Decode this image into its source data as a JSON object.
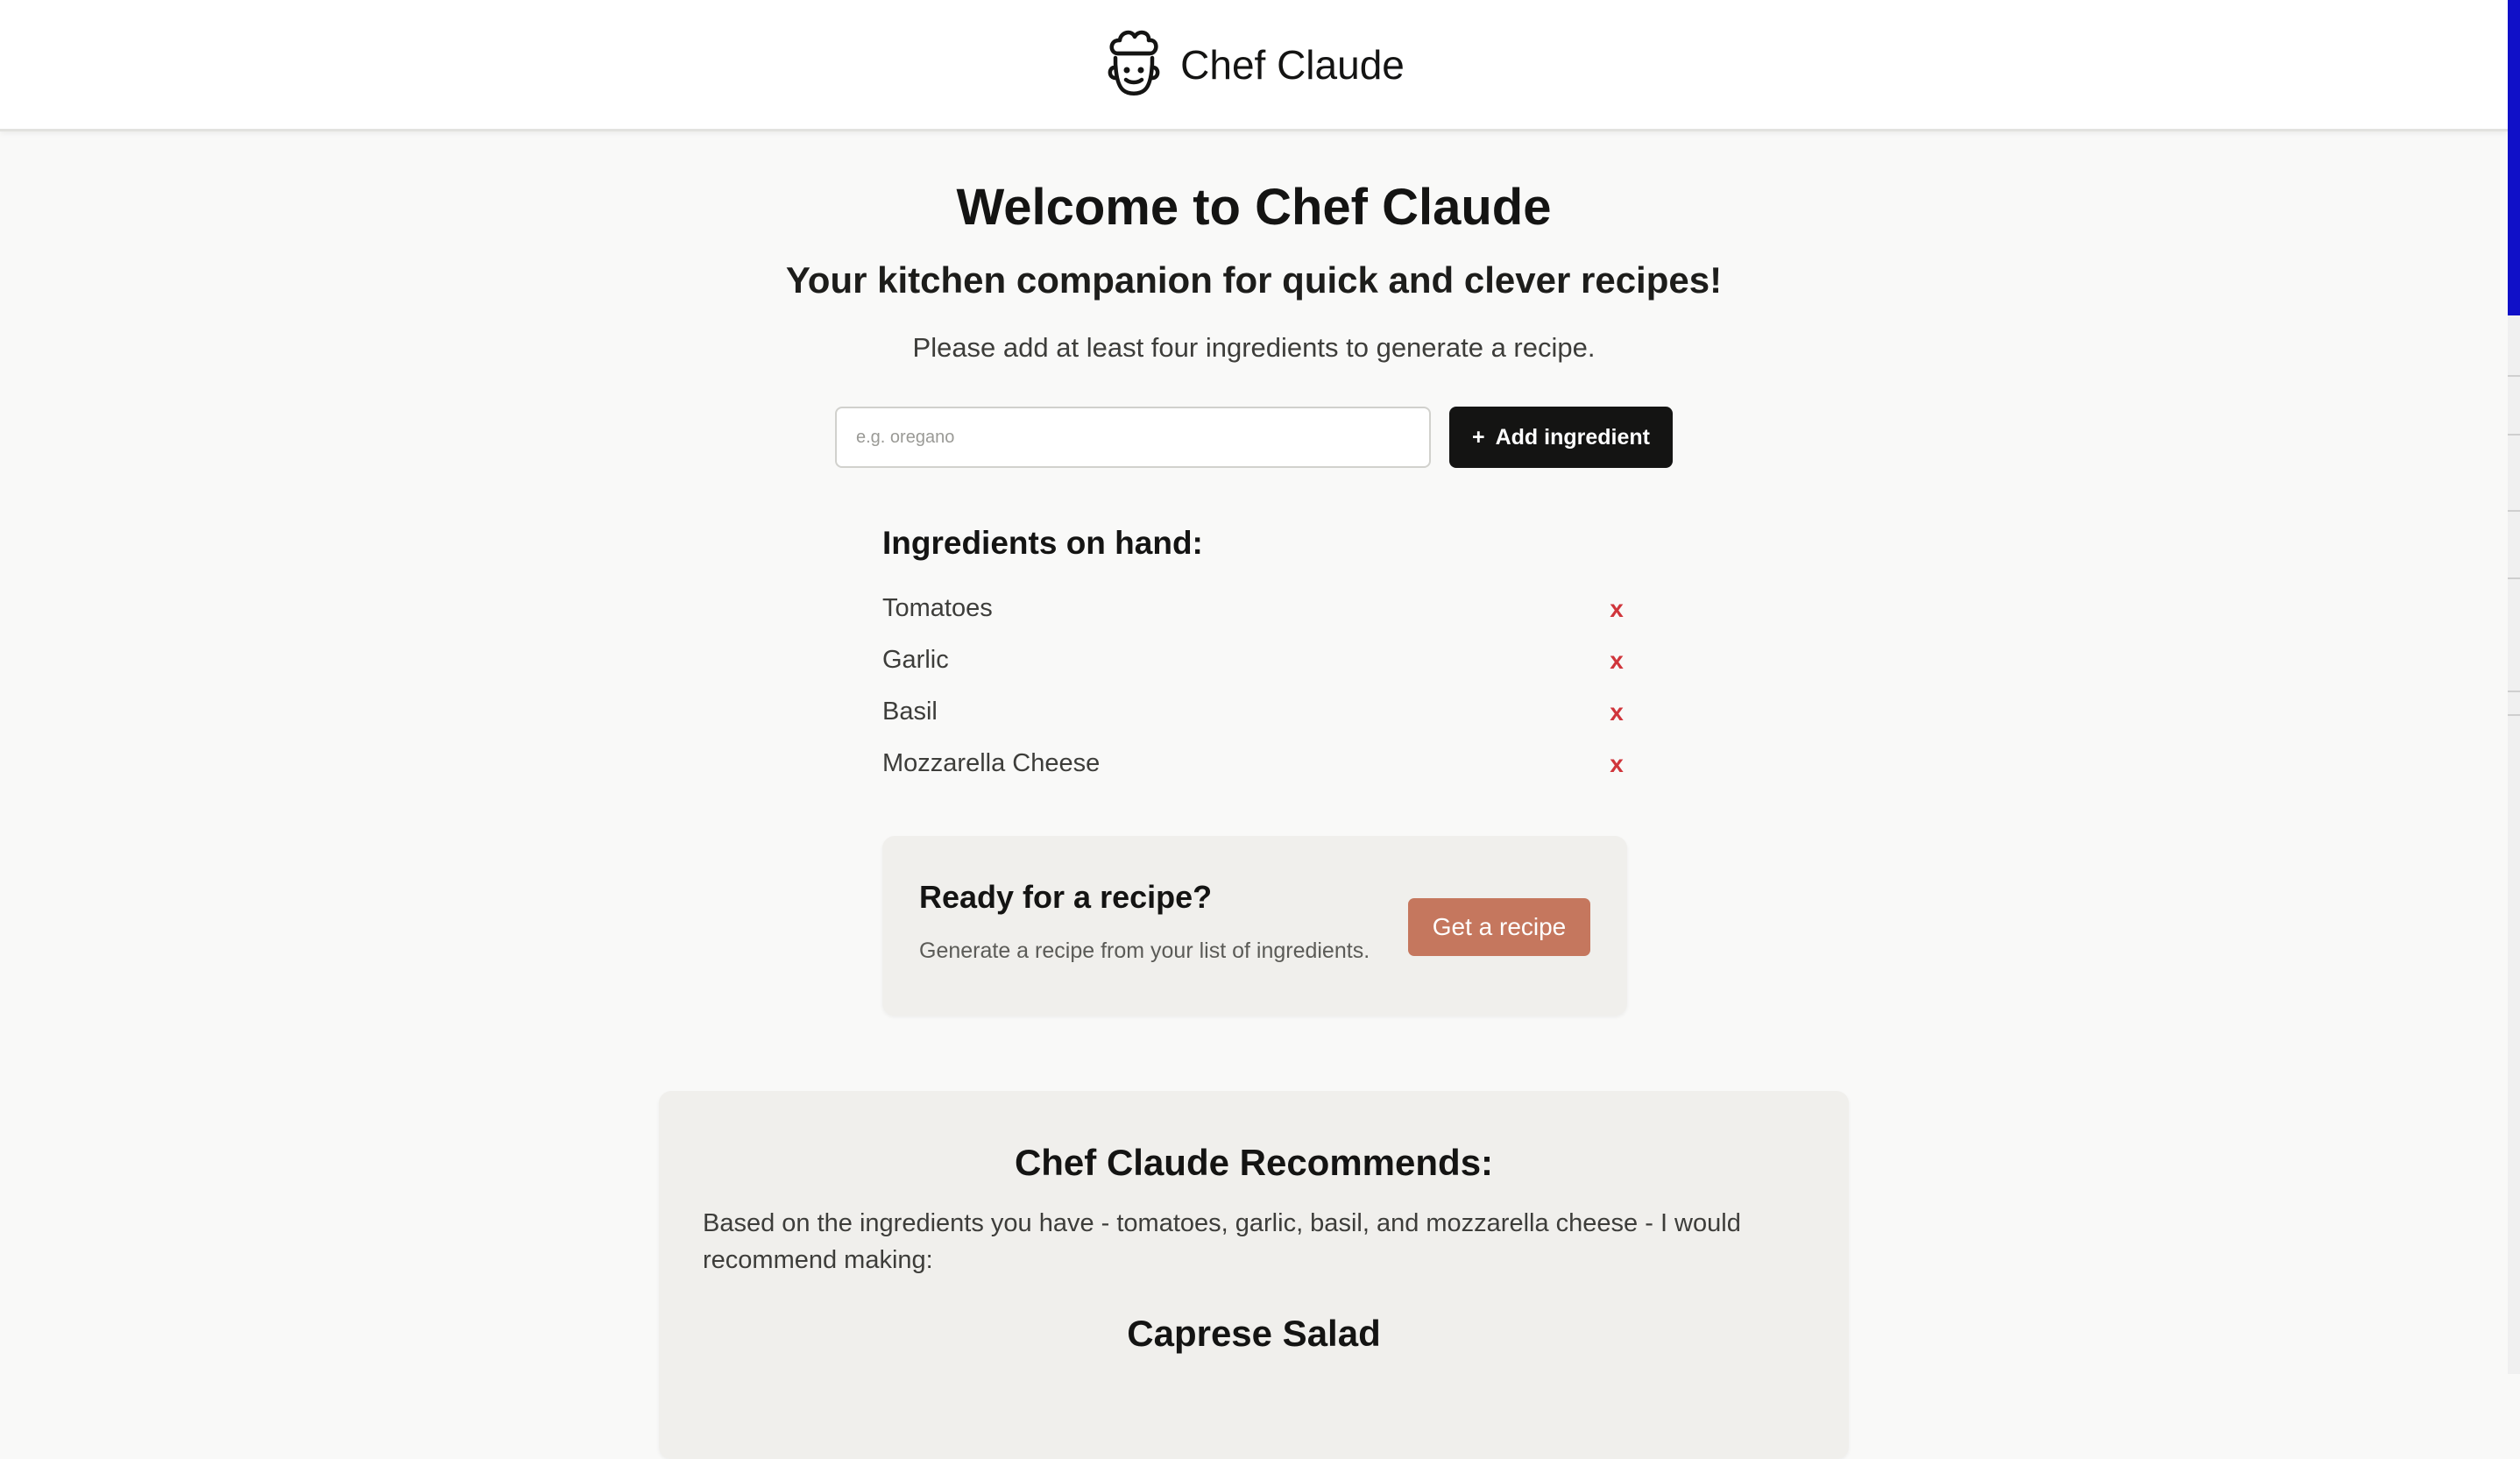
{
  "header": {
    "title": "Chef Claude",
    "logo_icon": "chef-hat-face-icon"
  },
  "hero": {
    "title": "Welcome to Chef Claude",
    "subtitle": "Your kitchen companion for quick and clever recipes!",
    "instructions": "Please add at least four ingredients to generate a recipe."
  },
  "form": {
    "placeholder": "e.g. oregano",
    "value": "",
    "add_button_icon": "+",
    "add_button_label": "Add ingredient"
  },
  "ingredients": {
    "heading": "Ingredients on hand:",
    "items": [
      {
        "name": "Tomatoes",
        "remove": "x"
      },
      {
        "name": "Garlic",
        "remove": "x"
      },
      {
        "name": "Basil",
        "remove": "x"
      },
      {
        "name": "Mozzarella Cheese",
        "remove": "x"
      }
    ]
  },
  "cta": {
    "title": "Ready for a recipe?",
    "subtitle": "Generate a recipe from your list of ingredients.",
    "button_label": "Get a recipe"
  },
  "recommendation": {
    "heading": "Chef Claude Recommends:",
    "intro": "Based on the ingredients you have - tomatoes, garlic, basil, and mozzarella cheese - I would recommend making:",
    "dish": "Caprese Salad"
  },
  "colors": {
    "primary_dark": "#141413",
    "accent": "#c5775e",
    "remove": "#d0353b",
    "scrollbar_thumb": "#1010c8"
  }
}
